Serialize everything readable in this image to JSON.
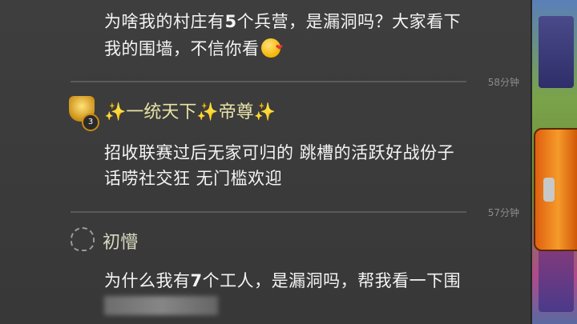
{
  "chat": {
    "messages": [
      {
        "text_line1_a": "为啥我的村庄有",
        "text_line1_b": "5",
        "text_line1_c": "个兵营，是漏洞吗？大家看下",
        "text_line2": "我的围墙，不信你看",
        "time": "58分钟"
      },
      {
        "username": "✨一统天下✨帝尊✨",
        "level": "3",
        "text_line1": "招收联赛过后无家可归的 跳槽的活跃好战份子",
        "text_line2": "话唠社交狂 无门槛欢迎",
        "time": "57分钟"
      },
      {
        "username": "初懵",
        "text_line1_a": "为什么我有",
        "text_line1_b": "7",
        "text_line1_c": "个工人，是漏洞吗，帮我看一下围"
      }
    ]
  },
  "icons": {
    "emoji": "kiss-emoji-icon",
    "league_badge": "league-badge-icon",
    "empty_badge": "empty-clan-badge-icon",
    "toggle": "panel-toggle-icon"
  },
  "colors": {
    "accent_orange": "#f59a2a",
    "username_gold": "#e8e2a8"
  }
}
